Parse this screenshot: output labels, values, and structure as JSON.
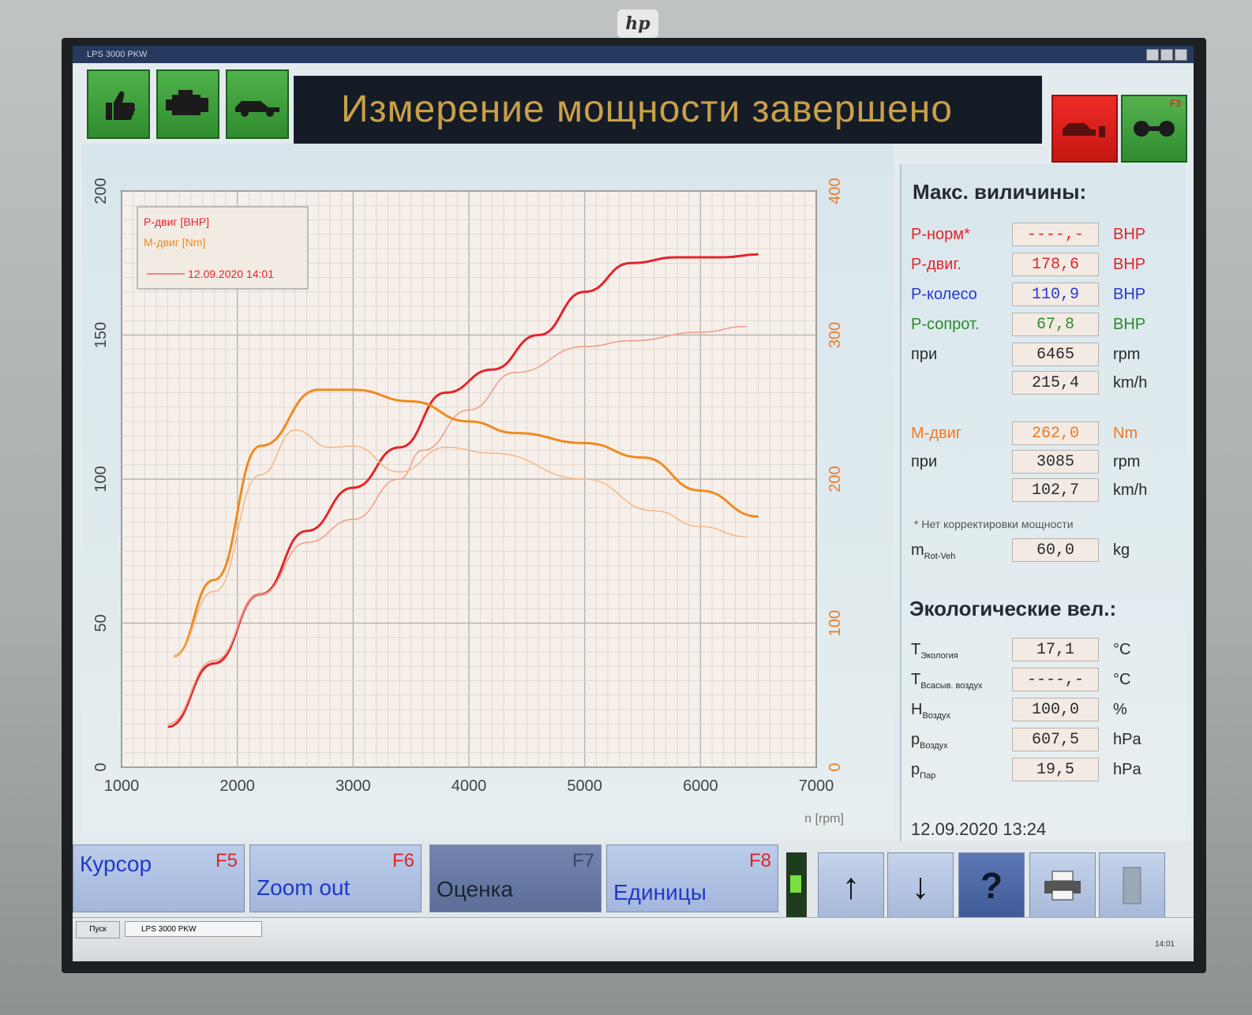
{
  "window": {
    "title": "LPS 3000 PKW"
  },
  "header": {
    "status_text": "Измерение мощности завершено",
    "buttons": [
      {
        "name": "thumbs-up-icon"
      },
      {
        "name": "engine-icon"
      },
      {
        "name": "car-icon"
      }
    ],
    "f3_label": "F3"
  },
  "chart_data": {
    "type": "line",
    "x_ticks": [
      "1000",
      "2000",
      "3000",
      "4000",
      "5000",
      "6000",
      "7000"
    ],
    "xlabel": "n [rpm]",
    "xlim": [
      1000,
      7000
    ],
    "left_ticks": [
      "0",
      "50",
      "100",
      "150",
      "200"
    ],
    "left_lim": [
      0,
      200
    ],
    "right_ticks": [
      "0",
      "100",
      "200",
      "300",
      "400"
    ],
    "right_lim": [
      0,
      400
    ],
    "grid": true,
    "legend": {
      "placement": "top-left",
      "entries": [
        "P-двиг [BHP]",
        "M-двиг [Nm]"
      ],
      "date_label": "12.09.2020 14:01"
    },
    "series": [
      {
        "color": "#e3252b",
        "axis": "left",
        "x": [
          1400,
          1800,
          2200,
          2600,
          3000,
          3400,
          3800,
          4200,
          4600,
          5000,
          5400,
          5800,
          6200,
          6500
        ],
        "y": [
          14,
          36,
          60,
          82,
          97,
          111,
          130,
          138,
          150,
          165,
          175,
          177,
          177,
          178
        ]
      },
      {
        "color": "#f0a089",
        "axis": "left",
        "x": [
          1400,
          1800,
          2200,
          2600,
          3000,
          3400,
          3600,
          4000,
          4400,
          5000,
          5400,
          6000,
          6400
        ],
        "y": [
          15,
          37,
          60,
          78,
          86,
          100,
          110,
          124,
          137,
          146,
          148,
          151,
          153
        ]
      },
      {
        "color": "#f08a20",
        "axis": "right",
        "x": [
          1450,
          1800,
          2200,
          2700,
          3000,
          3500,
          4000,
          4400,
          5000,
          5500,
          6000,
          6500
        ],
        "y": [
          77,
          130,
          223,
          262,
          262,
          254,
          240,
          232,
          225,
          215,
          192,
          174
        ]
      },
      {
        "color": "#f3b98b",
        "axis": "right",
        "x": [
          1450,
          1800,
          2200,
          2500,
          2800,
          3000,
          3400,
          3800,
          4200,
          5000,
          5600,
          6000,
          6400
        ],
        "y": [
          77,
          122,
          203,
          234,
          222,
          223,
          205,
          222,
          218,
          200,
          178,
          167,
          160
        ]
      }
    ]
  },
  "panel": {
    "title": "Макс. виличины:",
    "rows": [
      {
        "label": "P-норм*",
        "value": "----,-",
        "unit": "BHP",
        "color": "red"
      },
      {
        "label": "P-двиг.",
        "value": "178,6",
        "unit": "BHP",
        "color": "red"
      },
      {
        "label": "P-колесо",
        "value": "110,9",
        "unit": "BHP",
        "color": "blue"
      },
      {
        "label": "P-сопрот.",
        "value": "67,8",
        "unit": "BHP",
        "color": "green"
      },
      {
        "label": "при",
        "value": "6465",
        "unit": "rpm",
        "color": "dark"
      },
      {
        "label": "",
        "value": "215,4",
        "unit": "km/h",
        "color": "dark"
      },
      {
        "label": "M-двиг",
        "value": "262,0",
        "unit": "Nm",
        "color": "orange"
      },
      {
        "label": "при",
        "value": "3085",
        "unit": "rpm",
        "color": "dark"
      },
      {
        "label": "",
        "value": "102,7",
        "unit": "km/h",
        "color": "dark"
      }
    ],
    "note": "* Нет корректировки мощности",
    "mass": {
      "label": "m",
      "sub": "Rot-Veh",
      "value": "60,0",
      "unit": "kg"
    },
    "eco_title": "Экологические вел.:",
    "eco_rows": [
      {
        "label": "T",
        "sub": "Экология",
        "value": "17,1",
        "unit": "°C"
      },
      {
        "label": "T",
        "sub": "Всасыв. воздух",
        "value": "----,-",
        "unit": "°C"
      },
      {
        "label": "H",
        "sub": "Воздух",
        "value": "100,0",
        "unit": "%"
      },
      {
        "label": "p",
        "sub": "Воздух",
        "value": "607,5",
        "unit": "hPa"
      },
      {
        "label": "p",
        "sub": "Пар",
        "value": "19,5",
        "unit": "hPa"
      }
    ],
    "timestamp": "12.09.2020  13:24"
  },
  "footer": {
    "fkeys": [
      {
        "label": "Курсор",
        "key": "F5"
      },
      {
        "label": "Zoom out",
        "key": "F6"
      },
      {
        "label": "Оценка",
        "key": "F7"
      },
      {
        "label": "Единицы",
        "key": "F8"
      }
    ],
    "icons": [
      "arrow-up-icon",
      "arrow-down-icon",
      "help-icon",
      "printer-icon",
      "exit-icon"
    ]
  },
  "taskbar": {
    "start_label": "Пуск",
    "task_label": "LPS 3000 PKW",
    "clock": "14:01"
  }
}
